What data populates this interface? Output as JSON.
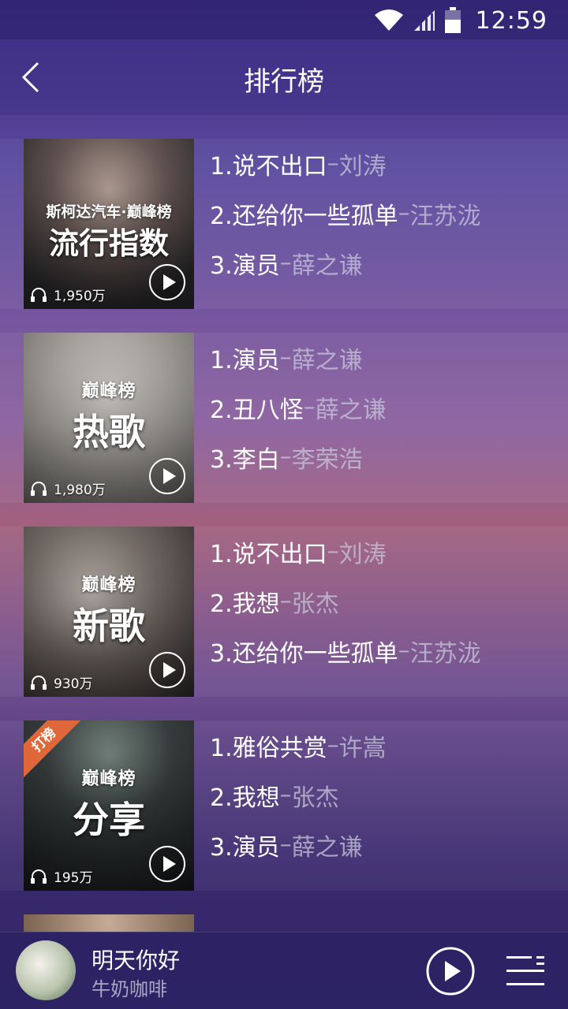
{
  "status_bar": {
    "time": "12:59"
  },
  "header": {
    "title": "排行榜"
  },
  "charts": [
    {
      "sponsor": "斯柯达汽车·巅峰榜",
      "logo": "",
      "cover_title": "流行指数",
      "plays": "1,950万",
      "ribbon": "",
      "tracks": [
        {
          "name": "1.说不出口",
          "artist": "刘涛"
        },
        {
          "name": "2.还给你一些孤单",
          "artist": "汪苏泷"
        },
        {
          "name": "3.演员",
          "artist": "薛之谦"
        }
      ]
    },
    {
      "sponsor": "",
      "logo": "巅峰榜",
      "cover_title": "热歌",
      "plays": "1,980万",
      "ribbon": "",
      "tracks": [
        {
          "name": "1.演员",
          "artist": "薛之谦"
        },
        {
          "name": "2.丑八怪",
          "artist": "薛之谦"
        },
        {
          "name": "3.李白",
          "artist": "李荣浩"
        }
      ]
    },
    {
      "sponsor": "",
      "logo": "巅峰榜",
      "cover_title": "新歌",
      "plays": "930万",
      "ribbon": "",
      "tracks": [
        {
          "name": "1.说不出口",
          "artist": "刘涛"
        },
        {
          "name": "2.我想",
          "artist": "张杰"
        },
        {
          "name": "3.还给你一些孤单",
          "artist": "汪苏泷"
        }
      ]
    },
    {
      "sponsor": "",
      "logo": "巅峰榜",
      "cover_title": "分享",
      "plays": "195万",
      "ribbon": "打榜",
      "tracks": [
        {
          "name": "1.雅俗共赏",
          "artist": "许嵩"
        },
        {
          "name": "2.我想",
          "artist": "张杰"
        },
        {
          "name": "3.演员",
          "artist": "薛之谦"
        }
      ]
    }
  ],
  "separator": "–",
  "player": {
    "song": "明天你好",
    "artist": "牛奶咖啡"
  },
  "colors": {
    "accent": "#3f2f86",
    "ribbon": "#e0673a"
  }
}
